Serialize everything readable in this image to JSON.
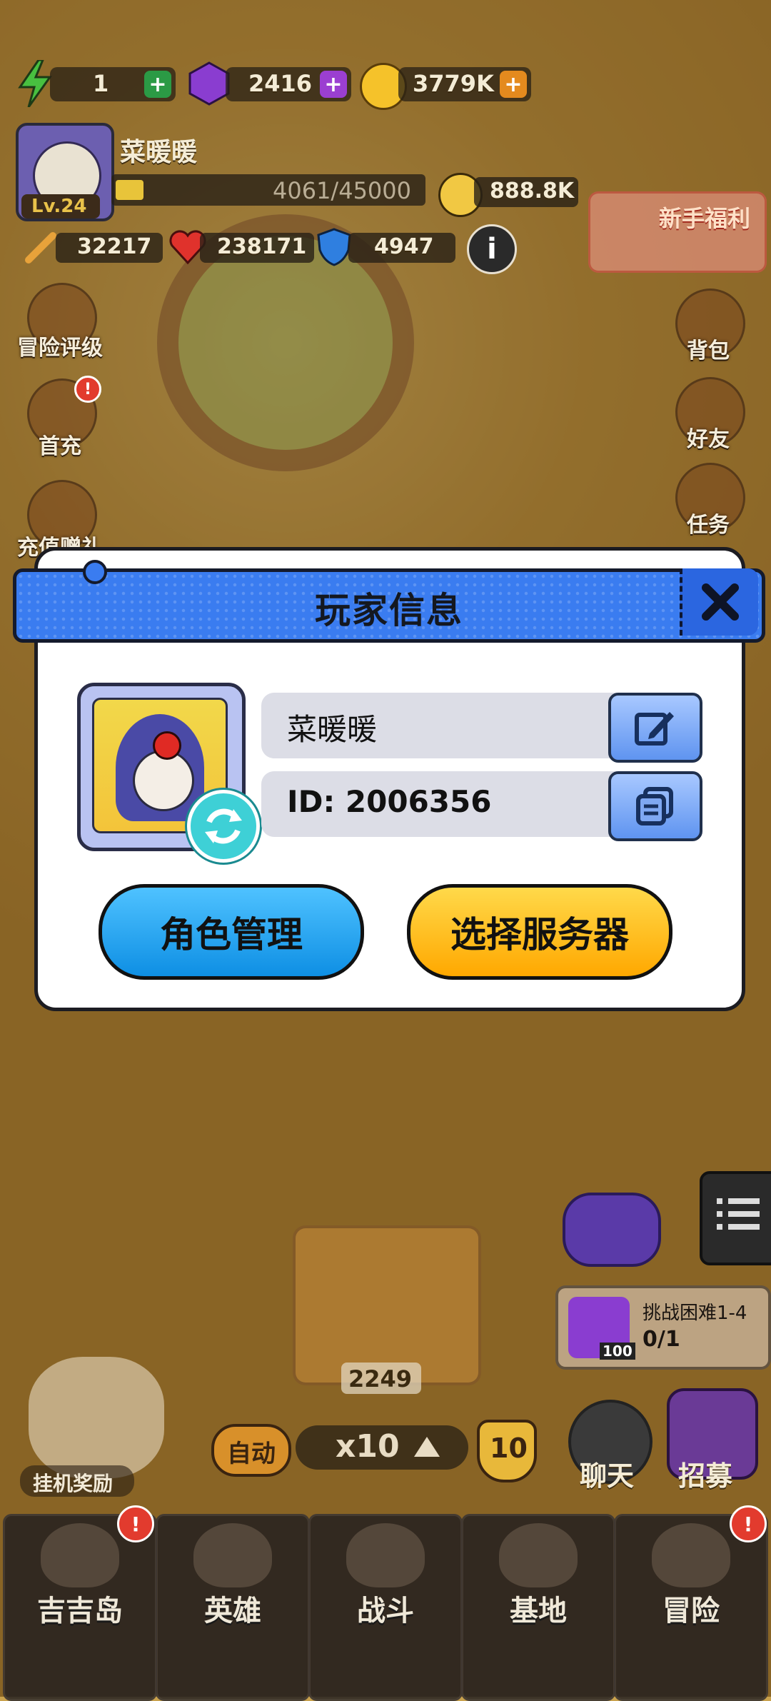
{
  "hud": {
    "energy": "1",
    "gems": "2416",
    "coins": "3779K",
    "player_name": "菜暖暖",
    "level": "Lv.24",
    "exp": "4061/45000",
    "exp_progress": 0.09,
    "power": "888.8K",
    "attack": "32217",
    "hp": "238171",
    "defense": "4947",
    "newbie_label": "新手福利"
  },
  "left_menu": [
    {
      "label": "冒险评级"
    },
    {
      "label": "首充"
    },
    {
      "label": "充值赠礼"
    }
  ],
  "right_menu": [
    {
      "label": "背包"
    },
    {
      "label": "好友"
    },
    {
      "label": "任务"
    }
  ],
  "dialog": {
    "title": "玩家信息",
    "name": "菜暖暖",
    "id_text": "ID: 2006356",
    "role_button": "角色管理",
    "server_button": "选择服务器"
  },
  "lower": {
    "chest_count": "2249",
    "challenge_title": "挑战困难1-4",
    "challenge_progress": "0/1",
    "challenge_gem": "100",
    "auto_label": "自动",
    "multiplier": "x10",
    "level_badge": "10",
    "idle_reward": "挂机奖励",
    "chat": "聊天",
    "recruit": "招募"
  },
  "nav": [
    {
      "label": "吉吉岛",
      "badge": "!"
    },
    {
      "label": "英雄"
    },
    {
      "label": "战斗"
    },
    {
      "label": "基地"
    },
    {
      "label": "冒险",
      "badge": "!"
    }
  ],
  "colors": {
    "dialog_header": "#3a7cf0",
    "role_button": "#14a3f0",
    "server_button": "#ffb800"
  }
}
